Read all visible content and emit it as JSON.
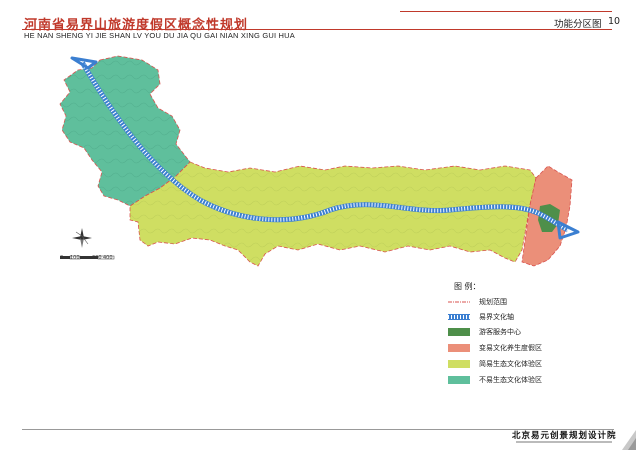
{
  "header": {
    "title_cn": "河南省易界山旅游度假区概念性规划",
    "title_en": "HE NAN SHENG YI JIE SHAN LV YOU DU JIA QU GAI NIAN XING GUI HUA",
    "map_label": "功能分区图",
    "page_number": "10"
  },
  "scale": {
    "ticks": [
      "0",
      "100",
      "300",
      "400"
    ]
  },
  "legend": {
    "title": "图  例：",
    "items": [
      {
        "label": "规划范围",
        "color": "#d9534f"
      },
      {
        "label": "易界文化轴",
        "color": "#3b7fd1"
      },
      {
        "label": "游客服务中心",
        "color": "#4e8f4a"
      },
      {
        "label": "变易文化养生度假区",
        "color": "#eb8f79"
      },
      {
        "label": "简易生态文化体验区",
        "color": "#cfde62"
      },
      {
        "label": "不易生态文化体验区",
        "color": "#5fbf9c"
      }
    ]
  },
  "footer": {
    "org": "北京易元创景规划设计院"
  }
}
